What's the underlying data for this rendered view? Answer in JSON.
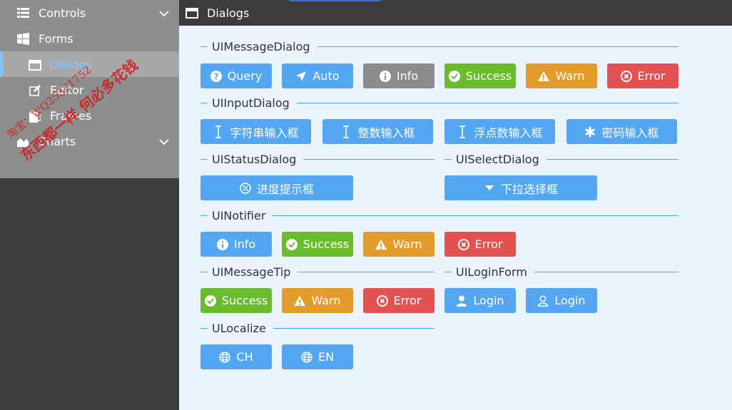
{
  "sidebar": {
    "items": [
      {
        "label": "Controls",
        "icon": "list-icon",
        "expandable": true
      },
      {
        "label": "Forms",
        "icon": "windows-icon"
      },
      {
        "label": "Dialogs",
        "icon": "window-icon",
        "active": true
      },
      {
        "label": "Editor",
        "icon": "edit-icon"
      },
      {
        "label": "Frames",
        "icon": "frames-icon"
      },
      {
        "label": "Charts",
        "icon": "area-chart-icon",
        "expandable": true
      }
    ]
  },
  "watermark": {
    "line1": "淘宝：WQ25321752",
    "line2": "东西都一样 何必多花钱"
  },
  "header": {
    "title": "Dialogs",
    "icon": "window-icon"
  },
  "groups": {
    "message_dialog": "UIMessageDialog",
    "input_dialog": "UIInputDialog",
    "status_dialog": "UIStatusDialog",
    "select_dialog": "UISelectDialog",
    "notifier": "UINotifier",
    "message_tip": "UIMessageTip",
    "login_form": "UILoginForm",
    "localize": "ULocalize"
  },
  "message_dialog_buttons": {
    "query": "Query",
    "auto": "Auto",
    "info": "Info",
    "success": "Success",
    "warn": "Warn",
    "error": "Error"
  },
  "input_dialog_buttons": {
    "string": "字符串输入框",
    "integer": "整数输入框",
    "float": "浮点数输入框",
    "password": "密码输入框"
  },
  "status_dialog_buttons": {
    "progress": "进度提示框"
  },
  "select_dialog_buttons": {
    "dropdown": "下拉选择框"
  },
  "notifier_buttons": {
    "info": "Info",
    "success": "Success",
    "warn": "Warn",
    "error": "Error"
  },
  "message_tip_buttons": {
    "success": "Success",
    "warn": "Warn",
    "error": "Error"
  },
  "login_form_buttons": {
    "login1": "Login",
    "login2": "Login"
  },
  "localize_buttons": {
    "ch": "CH",
    "en": "EN"
  },
  "colors": {
    "primary": "#53a6f1",
    "gray": "#8c8c8c",
    "success": "#6abc2d",
    "warn": "#e39b2b",
    "error": "#e35252",
    "active_text": "#7ec6ff",
    "content_bg": "#ebf3fc",
    "dark_bg": "#3c3c3c"
  }
}
